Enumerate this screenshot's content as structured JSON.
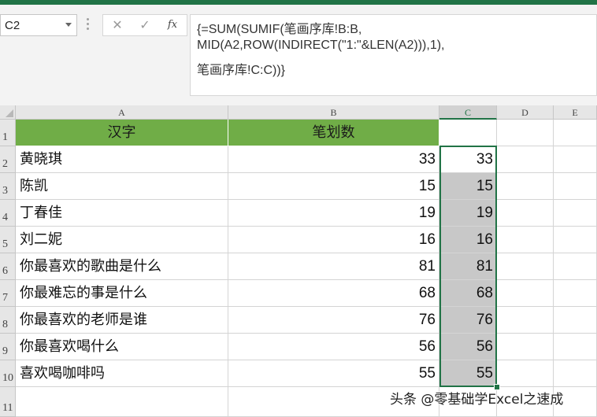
{
  "name_box": {
    "value": "C2"
  },
  "formula_bar": {
    "cancel_icon": "✕",
    "enter_icon": "✓",
    "fx_label": "fx",
    "lines": [
      "{=SUM(SUMIF(笔画序库!B:B,",
      "MID(A2,ROW(INDIRECT(\"1:\"&LEN(A2))),1),",
      "笔画序库!C:C))}"
    ]
  },
  "columns": [
    "A",
    "B",
    "C",
    "D",
    "E"
  ],
  "row_numbers": [
    "1",
    "2",
    "3",
    "4",
    "5",
    "6",
    "7",
    "8",
    "9",
    "10",
    "11"
  ],
  "header_row": {
    "a": "汉字",
    "b": "笔划数"
  },
  "rows": [
    {
      "a": "黄晓琪",
      "b": "33",
      "c": "33"
    },
    {
      "a": "陈凯",
      "b": "15",
      "c": "15"
    },
    {
      "a": "丁春佳",
      "b": "19",
      "c": "19"
    },
    {
      "a": "刘二妮",
      "b": "16",
      "c": "16"
    },
    {
      "a": "你最喜欢的歌曲是什么",
      "b": "81",
      "c": "81"
    },
    {
      "a": "你最难忘的事是什么",
      "b": "68",
      "c": "68"
    },
    {
      "a": "你最喜欢的老师是谁",
      "b": "76",
      "c": "76"
    },
    {
      "a": "你最喜欢喝什么",
      "b": "56",
      "c": "56"
    },
    {
      "a": "喜欢喝咖啡吗",
      "b": "55",
      "c": "55"
    }
  ],
  "watermark": "头条 @零基础学Excel之速成",
  "colors": {
    "header_fill": "#70ad47",
    "selection_fill": "#c8c8c8",
    "accent": "#217346"
  }
}
